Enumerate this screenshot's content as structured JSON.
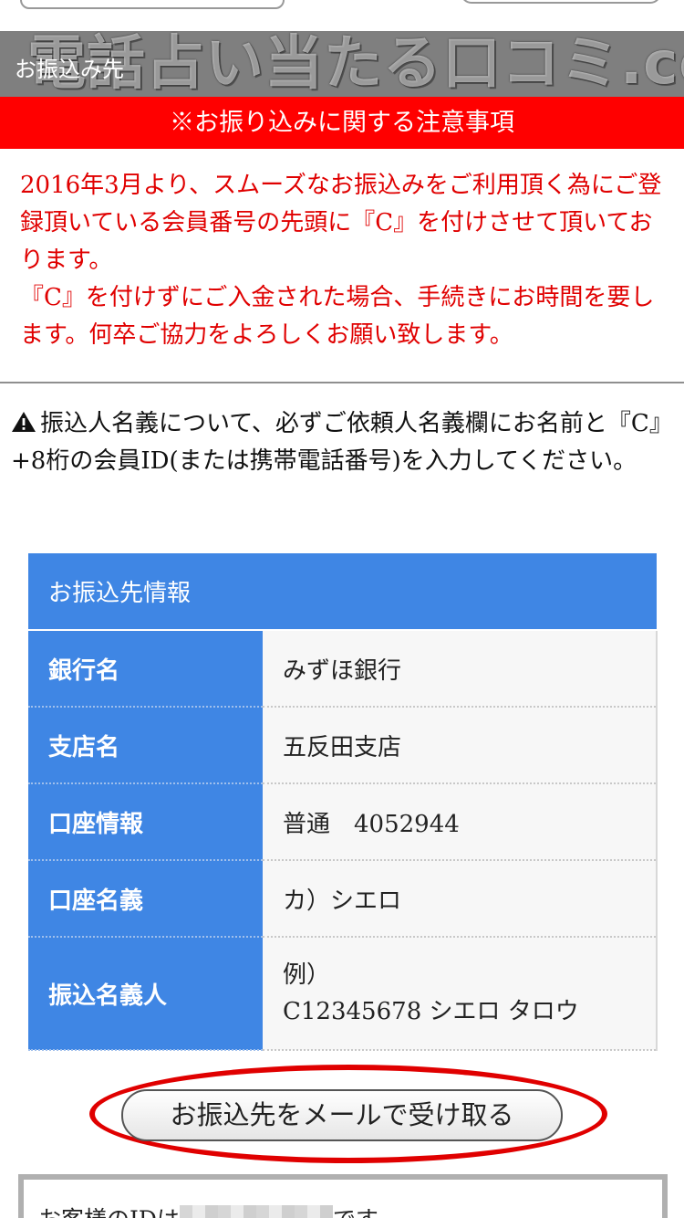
{
  "section_header": {
    "label": "お振込み先",
    "watermark": "電話占い当たる口コミ.com"
  },
  "notice": {
    "banner": "※お振り込みに関する注意事項",
    "paragraph1": "2016年3月より、スムーズなお振込みをご利用頂く為にご登録頂いている会員番号の先頭に『C』を付けさせて頂いております。",
    "paragraph2": "『C』を付けずにご入金された場合、手続きにお時間を要します。何卒ご協力をよろしくお願い致します。"
  },
  "warning": {
    "icon": "warning-icon",
    "text": "振込人名義について、必ずご依頼人名義欄にお名前と『C』+8桁の会員ID(または携帯電話番号)を入力してください。"
  },
  "bank_info": {
    "title": "お振込先情報",
    "rows": [
      {
        "label": "銀行名",
        "value": "みずほ銀行"
      },
      {
        "label": "支店名",
        "value": "五反田支店"
      },
      {
        "label": "口座情報",
        "value": "普通　4052944"
      },
      {
        "label": "口座名義",
        "value": "カ）シエロ"
      },
      {
        "label": "振込名義人",
        "value_line1": "例）",
        "value_line2": "C12345678 シエロ タロウ"
      }
    ]
  },
  "mail_button": {
    "label": "お振込先をメールで受け取る"
  },
  "id_box": {
    "prefix": "お客様のIDは",
    "suffix": "です。"
  },
  "colors": {
    "banner_red": "#ff0000",
    "notice_text_red": "#e00000",
    "table_blue": "#3f86e4",
    "header_gray": "#7f7f7f"
  }
}
